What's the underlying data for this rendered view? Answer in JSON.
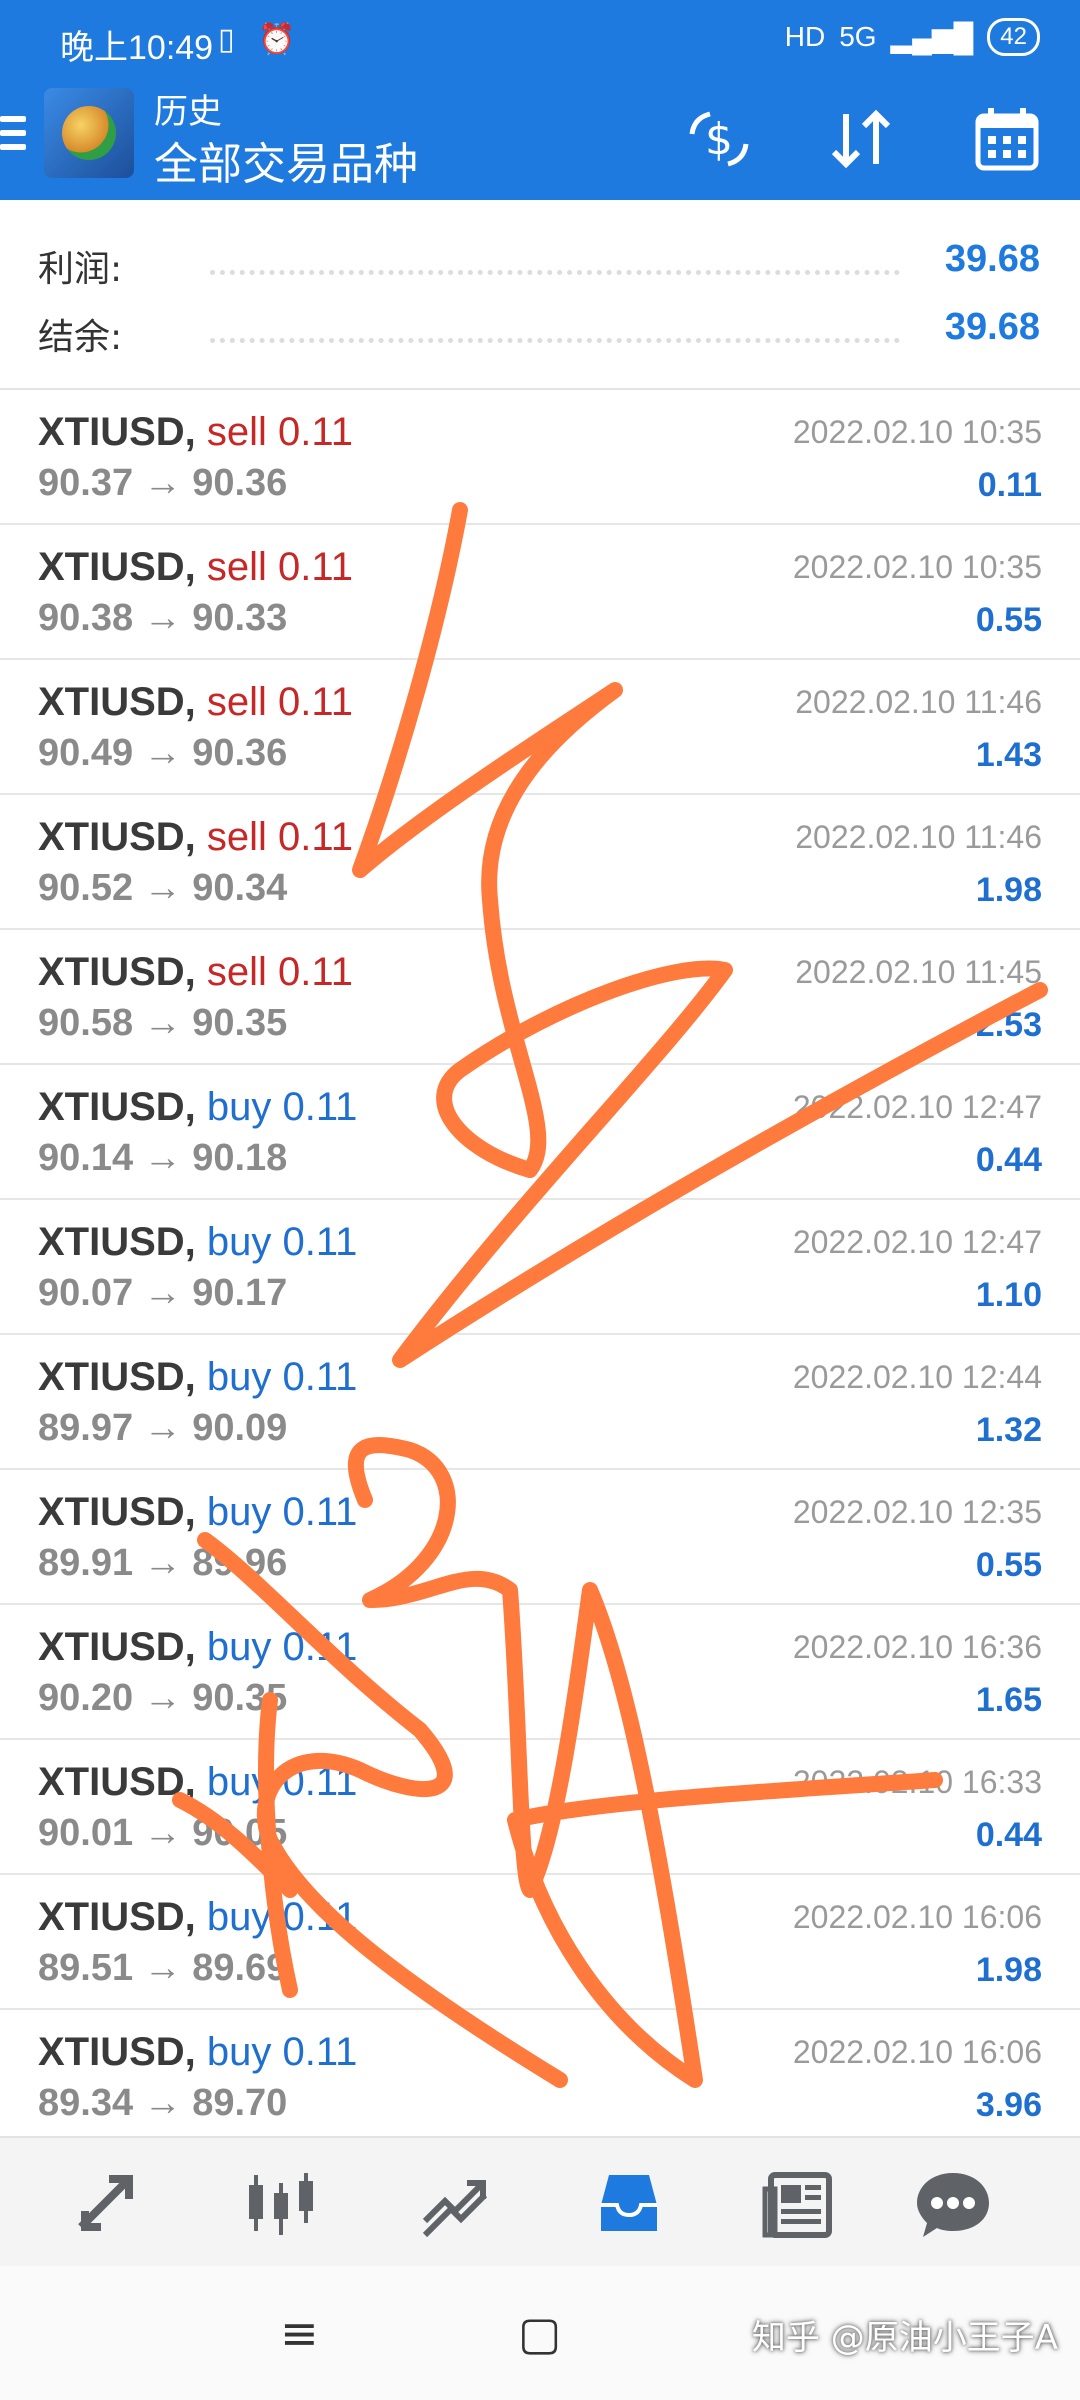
{
  "status_bar": {
    "time": "晚上10:49",
    "network": "5G",
    "battery": "42"
  },
  "header": {
    "subtitle": "历史",
    "title": "全部交易品种",
    "icons": [
      "currency-exchange-icon",
      "sort-icon",
      "calendar-icon"
    ]
  },
  "summary": {
    "profit_label": "利润:",
    "profit_value": "39.68",
    "balance_label": "结余:",
    "balance_value": "39.68"
  },
  "trades": [
    {
      "symbol": "XTIUSD,",
      "side": "sell 0.11",
      "type": "sell",
      "prices": "90.37 → 90.36",
      "time": "2022.02.10 10:35",
      "profit": "0.11"
    },
    {
      "symbol": "XTIUSD,",
      "side": "sell 0.11",
      "type": "sell",
      "prices": "90.38 → 90.33",
      "time": "2022.02.10 10:35",
      "profit": "0.55"
    },
    {
      "symbol": "XTIUSD,",
      "side": "sell 0.11",
      "type": "sell",
      "prices": "90.49 → 90.36",
      "time": "2022.02.10 11:46",
      "profit": "1.43"
    },
    {
      "symbol": "XTIUSD,",
      "side": "sell 0.11",
      "type": "sell",
      "prices": "90.52 → 90.34",
      "time": "2022.02.10 11:46",
      "profit": "1.98"
    },
    {
      "symbol": "XTIUSD,",
      "side": "sell 0.11",
      "type": "sell",
      "prices": "90.58 → 90.35",
      "time": "2022.02.10 11:45",
      "profit": "2.53"
    },
    {
      "symbol": "XTIUSD,",
      "side": "buy 0.11",
      "type": "buy",
      "prices": "90.14 → 90.18",
      "time": "2022.02.10 12:47",
      "profit": "0.44"
    },
    {
      "symbol": "XTIUSD,",
      "side": "buy 0.11",
      "type": "buy",
      "prices": "90.07 → 90.17",
      "time": "2022.02.10 12:47",
      "profit": "1.10"
    },
    {
      "symbol": "XTIUSD,",
      "side": "buy 0.11",
      "type": "buy",
      "prices": "89.97 → 90.09",
      "time": "2022.02.10 12:44",
      "profit": "1.32"
    },
    {
      "symbol": "XTIUSD,",
      "side": "buy 0.11",
      "type": "buy",
      "prices": "89.91 → 89.96",
      "time": "2022.02.10 12:35",
      "profit": "0.55"
    },
    {
      "symbol": "XTIUSD,",
      "side": "buy 0.11",
      "type": "buy",
      "prices": "90.20 → 90.35",
      "time": "2022.02.10 16:36",
      "profit": "1.65"
    },
    {
      "symbol": "XTIUSD,",
      "side": "buy 0.11",
      "type": "buy",
      "prices": "90.01 → 90.05",
      "time": "2022.02.10 16:33",
      "profit": "0.44"
    },
    {
      "symbol": "XTIUSD,",
      "side": "buy 0.11",
      "type": "buy",
      "prices": "89.51 → 89.69",
      "time": "2022.02.10 16:06",
      "profit": "1.98"
    },
    {
      "symbol": "XTIUSD,",
      "side": "buy 0.11",
      "type": "buy",
      "prices": "89.34 → 89.70",
      "time": "2022.02.10 16:06",
      "profit": "3.96"
    }
  ],
  "bottom_nav": [
    {
      "name": "quotes-icon",
      "active": false
    },
    {
      "name": "chart-icon",
      "active": false
    },
    {
      "name": "trade-icon",
      "active": false
    },
    {
      "name": "history-icon",
      "active": true
    },
    {
      "name": "news-icon",
      "active": false
    },
    {
      "name": "chat-icon",
      "active": false
    }
  ],
  "watermark": "知乎 @原油小王子A",
  "colors": {
    "header_blue": "#1f7ae0",
    "sell_red": "#c62828",
    "buy_blue": "#1f6fd0",
    "scribble_orange": "#ff7a3d"
  }
}
